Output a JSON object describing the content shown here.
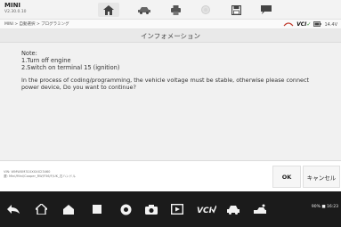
{
  "header": {
    "title": "MINI",
    "version": "V2.30.0.10",
    "buttons": [
      {
        "icon": "home-icon"
      },
      {
        "icon": "car-icon"
      },
      {
        "icon": "print-icon"
      },
      {
        "icon": "record-icon"
      },
      {
        "icon": "save-icon"
      },
      {
        "icon": "chat-icon"
      }
    ]
  },
  "breadcrumb": "MINI > 自動選択 > プログラミング",
  "status": {
    "vci_label": "VCI",
    "battery_text": "14.4V"
  },
  "page_title": "インフォメーション",
  "message": {
    "note_title": "Note:",
    "steps": [
      "1.Turn off engine",
      "2.Switch on terminal 15 (ignition)"
    ],
    "warning": "In the process of coding/programming, the vehicle voltage must be stable, otherwise please connect power device, Do you want to continue?"
  },
  "footer": {
    "vin": "VIN: WMWXM310XXXX23460",
    "path": "選: Mini/Mini/Cooper_RW/F56/F/UK_右ハンドル",
    "ok_label": "OK",
    "cancel_label": "キャンセル"
  },
  "navbar": {
    "icons": [
      "back-icon",
      "home-icon",
      "house-icon",
      "square-icon",
      "chrome-icon",
      "camera-icon",
      "screen-record-icon",
      "vci-icon",
      "car-scan-icon",
      "tools-icon"
    ],
    "status_text": "90% ■ 16:23"
  },
  "colors": {
    "accent_green": "#2a8a2a",
    "navbar_bg": "#1b1b1b",
    "content_bg": "#f1f1f1"
  }
}
